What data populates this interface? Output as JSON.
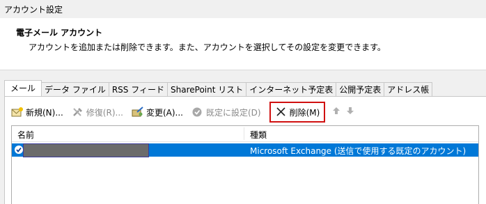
{
  "window": {
    "title": "アカウント設定"
  },
  "header": {
    "heading": "電子メール アカウント",
    "description": "アカウントを追加または削除できます。また、アカウントを選択してその設定を変更できます。"
  },
  "tabs": [
    {
      "label": "メール",
      "active": true
    },
    {
      "label": "データ ファイル"
    },
    {
      "label": "RSS フィード"
    },
    {
      "label": "SharePoint リスト"
    },
    {
      "label": "インターネット予定表"
    },
    {
      "label": "公開予定表"
    },
    {
      "label": "アドレス帳"
    }
  ],
  "toolbar": {
    "new_label": "新規(N)...",
    "repair_label": "修復(R)...",
    "change_label": "変更(A)...",
    "default_label": "既定に設定(D)",
    "delete_label": "削除(M)",
    "move_up_icon": "arrow-up-icon",
    "move_down_icon": "arrow-down-icon"
  },
  "list": {
    "columns": {
      "name": "名前",
      "type": "種類"
    },
    "rows": [
      {
        "name": "",
        "type": "Microsoft Exchange (送信で使用する既定のアカウント)",
        "selected": true
      }
    ]
  },
  "colors": {
    "selection": "#0078d7",
    "highlight_box": "#d01010",
    "redaction": "#6b6b6b"
  }
}
